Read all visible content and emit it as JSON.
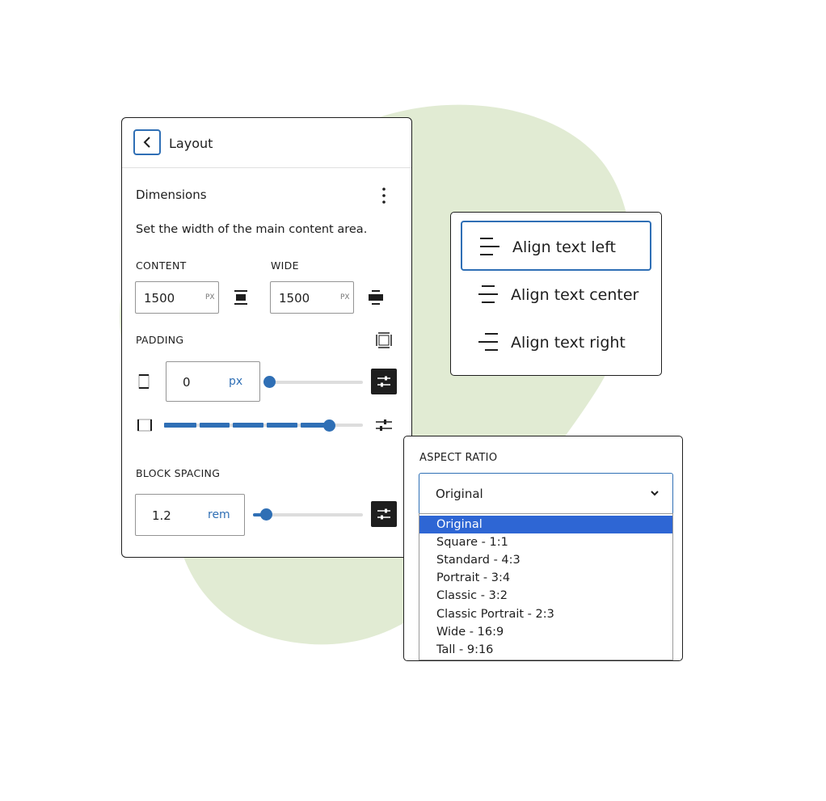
{
  "colors": {
    "accent": "#2f6fb5",
    "blob": "#e1ebd3",
    "dark": "#1e1e1e",
    "selected_option": "#2e66d4"
  },
  "layout_panel": {
    "title": "Layout",
    "back_icon": "chevron-left-icon",
    "section_title": "Dimensions",
    "description": "Set the width of the main content area.",
    "content": {
      "label": "CONTENT",
      "value": "1500",
      "unit": "PX"
    },
    "wide": {
      "label": "WIDE",
      "value": "1500",
      "unit": "PX"
    },
    "padding": {
      "label": "PADDING",
      "value": "0",
      "unit": "px"
    },
    "block_spacing": {
      "label": "BLOCK SPACING",
      "value": "1.2",
      "unit": "rem"
    }
  },
  "align_menu": {
    "items": [
      {
        "label": "Align text left",
        "icon": "align-left-icon",
        "selected": true
      },
      {
        "label": "Align text center",
        "icon": "align-center-icon",
        "selected": false
      },
      {
        "label": "Align text right",
        "icon": "align-right-icon",
        "selected": false
      }
    ]
  },
  "aspect_ratio": {
    "label": "ASPECT RATIO",
    "current": "Original",
    "options": [
      "Original",
      "Square - 1:1",
      "Standard - 4:3",
      "Portrait - 3:4",
      "Classic - 3:2",
      "Classic Portrait - 2:3",
      "Wide - 16:9",
      "Tall - 9:16"
    ]
  }
}
